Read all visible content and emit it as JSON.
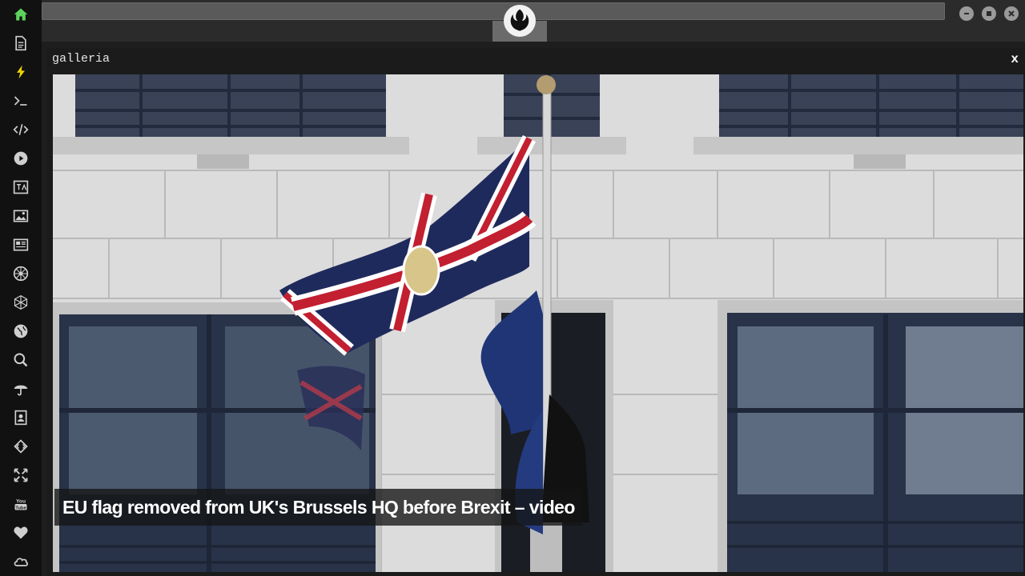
{
  "sidebar": {
    "items": [
      {
        "icon": "home-icon",
        "color": "#5dd35d"
      },
      {
        "icon": "document-icon",
        "color": "#cfcfcf"
      },
      {
        "icon": "lightning-icon",
        "color": "#f0d200"
      },
      {
        "icon": "terminal-icon",
        "color": "#cfcfcf"
      },
      {
        "icon": "code-icon",
        "color": "#cfcfcf"
      },
      {
        "icon": "play-icon",
        "color": "#cfcfcf"
      },
      {
        "icon": "translate-icon",
        "color": "#cfcfcf"
      },
      {
        "icon": "image-icon",
        "color": "#cfcfcf"
      },
      {
        "icon": "newspaper-icon",
        "color": "#cfcfcf"
      },
      {
        "icon": "galactic-empire-icon",
        "color": "#cfcfcf"
      },
      {
        "icon": "hexagon-network-icon",
        "color": "#cfcfcf"
      },
      {
        "icon": "globe-icon",
        "color": "#cfcfcf"
      },
      {
        "icon": "search-icon",
        "color": "#cfcfcf"
      },
      {
        "icon": "umbrella-icon",
        "color": "#cfcfcf"
      },
      {
        "icon": "contacts-icon",
        "color": "#cfcfcf"
      },
      {
        "icon": "code-diamond-icon",
        "color": "#cfcfcf"
      },
      {
        "icon": "fullscreen-icon",
        "color": "#cfcfcf"
      },
      {
        "icon": "youtube-icon",
        "color": "#cfcfcf"
      },
      {
        "icon": "heart-icon",
        "color": "#cfcfcf"
      },
      {
        "icon": "cloud-icon",
        "color": "#cfcfcf"
      }
    ]
  },
  "topbar": {
    "center_icon": "rebel-alliance-icon",
    "window_buttons": [
      "minimize-icon",
      "maximize-icon",
      "close-icon"
    ]
  },
  "panel": {
    "title": "galleria",
    "close_label": "x"
  },
  "gallery": {
    "caption": "EU flag removed from UK's Brussels HQ before Brexit – video"
  },
  "colors": {
    "sidebar_bg": "#111111",
    "topbar_bg": "#2b2b2b",
    "panel_bg": "#1b1b1b",
    "accent_home": "#5dd35d",
    "accent_lightning": "#f0d200"
  }
}
